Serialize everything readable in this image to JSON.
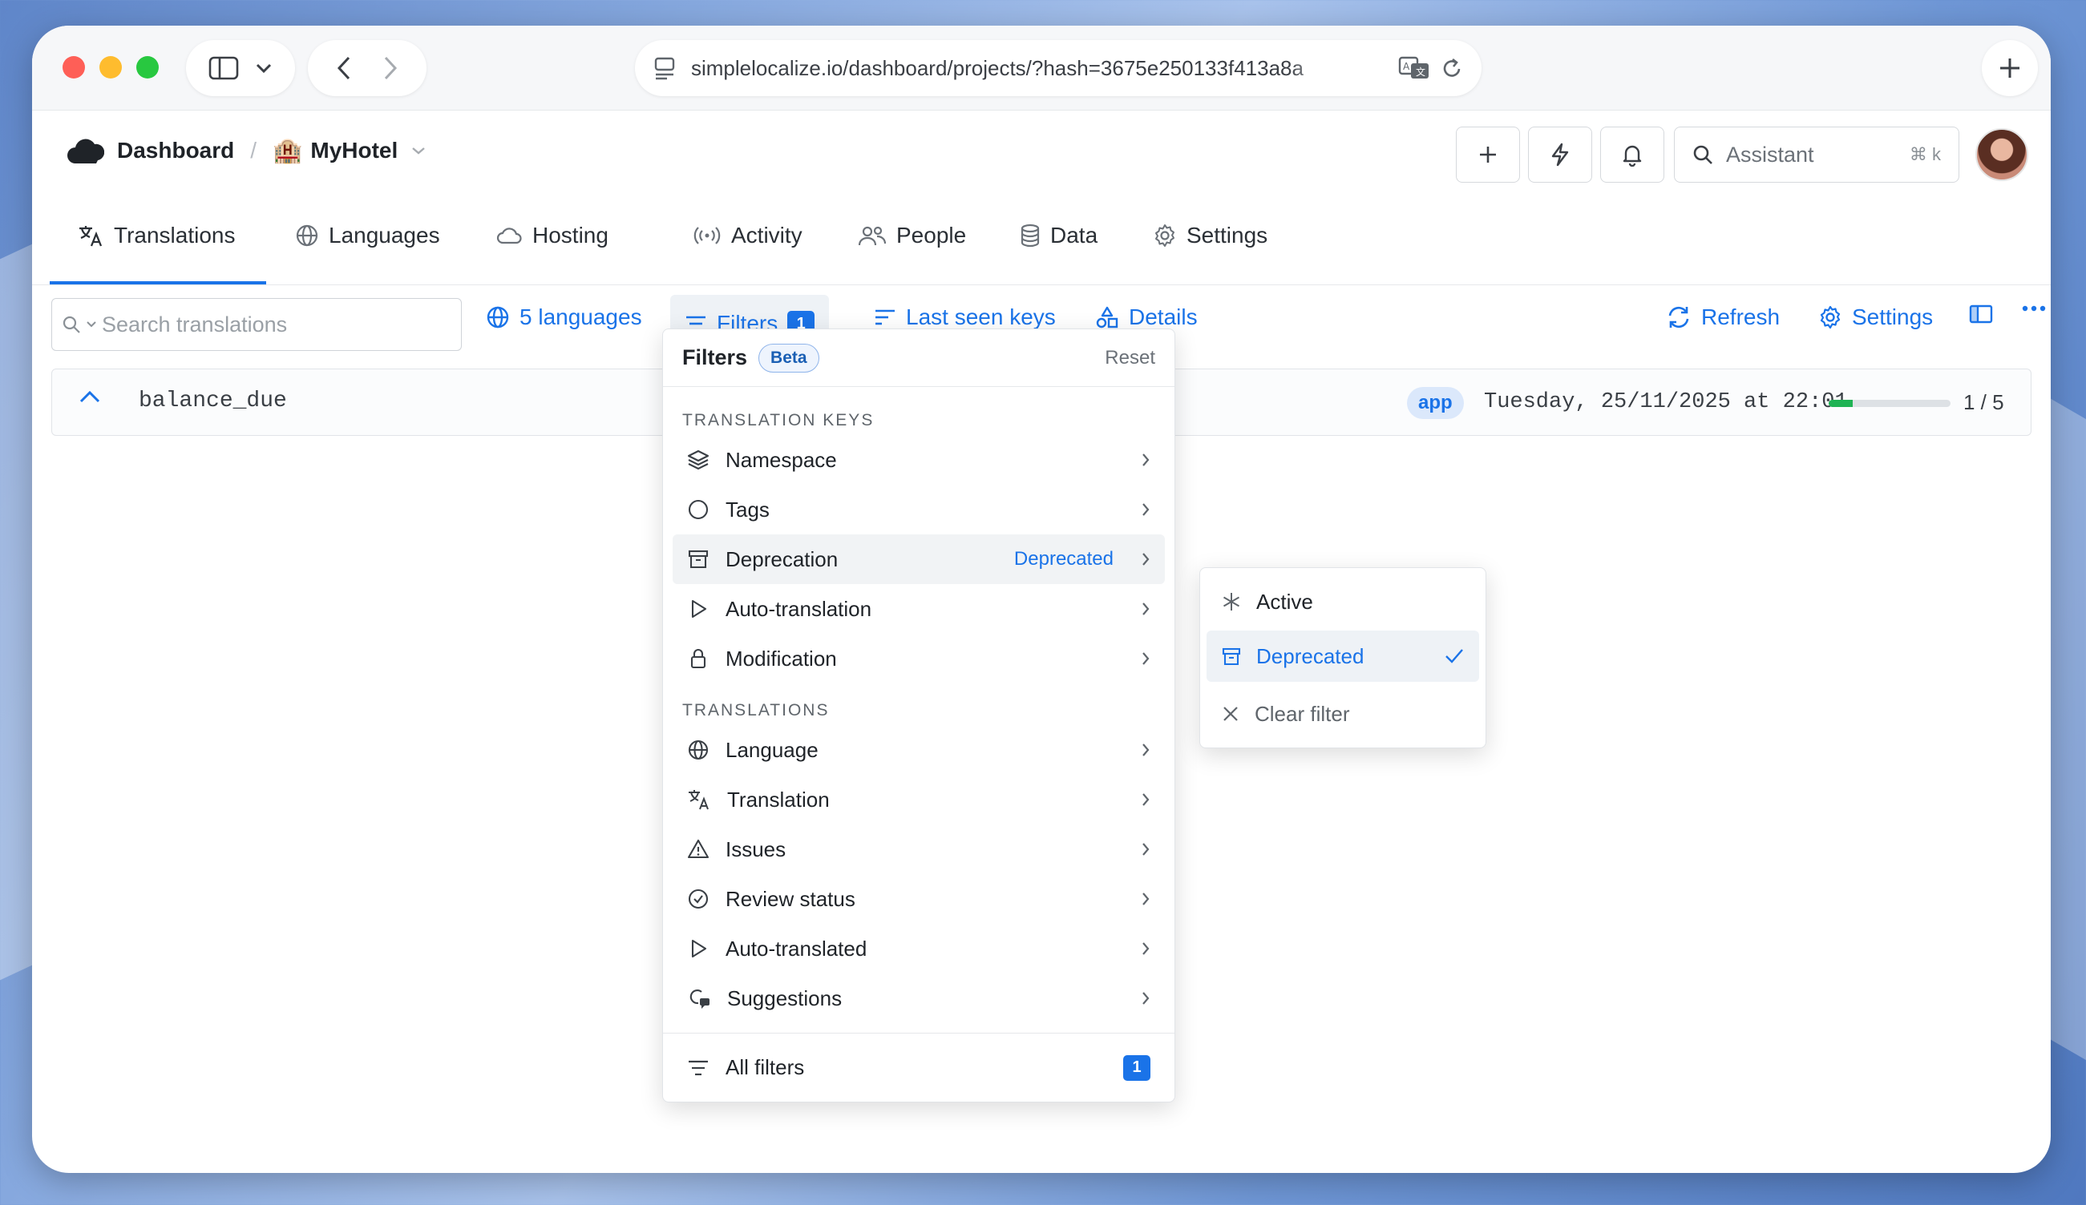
{
  "browser": {
    "url": "simplelocalize.io/dashboard/projects/?hash=3675e250133f413a8a"
  },
  "header": {
    "dashboard_label": "Dashboard",
    "separator": "/",
    "project_emoji": "🏨",
    "project_name": "MyHotel",
    "assistant_label": "Assistant",
    "assistant_shortcut": "⌘ k"
  },
  "tabs": [
    {
      "label": "Translations",
      "icon": "translate-icon",
      "active": true
    },
    {
      "label": "Languages",
      "icon": "globe-icon"
    },
    {
      "label": "Hosting",
      "icon": "cloud-icon"
    },
    {
      "label": "Activity",
      "icon": "broadcast-icon"
    },
    {
      "label": "People",
      "icon": "people-icon"
    },
    {
      "label": "Data",
      "icon": "database-icon"
    },
    {
      "label": "Settings",
      "icon": "gear-icon"
    }
  ],
  "toolbar": {
    "search_placeholder": "Search translations",
    "languages_label": "5 languages",
    "filters_label": "Filters",
    "filters_count": "1",
    "last_seen_label": "Last seen keys",
    "details_label": "Details",
    "refresh_label": "Refresh",
    "settings_label": "Settings"
  },
  "row": {
    "key": "balance_due",
    "namespace": "app",
    "date": "Tuesday, 25/11/2025 at 22:01",
    "progress": 0.2,
    "ratio": "1 / 5"
  },
  "filters_menu": {
    "title": "Filters",
    "badge": "Beta",
    "reset": "Reset",
    "section_keys": "TRANSLATION KEYS",
    "section_translations": "TRANSLATIONS",
    "keys_items": [
      {
        "label": "Namespace",
        "icon": "layers-icon"
      },
      {
        "label": "Tags",
        "icon": "circle-icon"
      },
      {
        "label": "Deprecation",
        "icon": "archive-icon",
        "value": "Deprecated"
      },
      {
        "label": "Auto-translation",
        "icon": "play-icon"
      },
      {
        "label": "Modification",
        "icon": "lock-icon"
      }
    ],
    "translation_items": [
      {
        "label": "Language",
        "icon": "globe-icon"
      },
      {
        "label": "Translation",
        "icon": "translate-icon"
      },
      {
        "label": "Issues",
        "icon": "warning-icon"
      },
      {
        "label": "Review status",
        "icon": "check-circle-icon"
      },
      {
        "label": "Auto-translated",
        "icon": "play-icon"
      },
      {
        "label": "Suggestions",
        "icon": "suggestion-icon"
      }
    ],
    "all_filters_label": "All filters",
    "all_filters_count": "1"
  },
  "deprecation_submenu": {
    "active_label": "Active",
    "deprecated_label": "Deprecated",
    "clear_label": "Clear filter"
  },
  "colors": {
    "accent": "#1a73e8",
    "progress": "#1fb354"
  }
}
